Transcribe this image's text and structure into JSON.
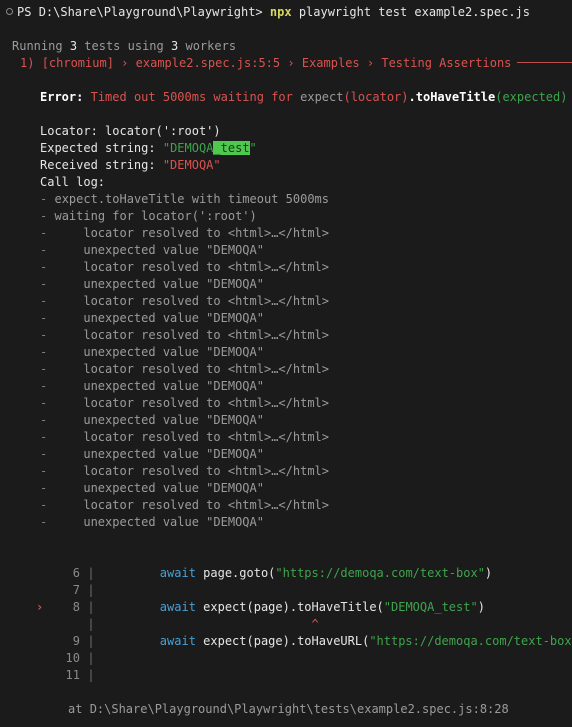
{
  "theme": {
    "background": "#1b1b1b",
    "foreground": "#cccccc",
    "red": "#d9534f",
    "green": "#3fa34d",
    "blue": "#4a9fd4",
    "yellow": "#d7d75f",
    "gray": "#9b9b9b",
    "highlight_bg": "#4ec94e",
    "highlight_fg": "#15361a"
  },
  "prompt": {
    "marker_icon": "circle-ring-icon",
    "shell": "PS",
    "path": "D:\\Share\\Playground\\Playwright>",
    "command_name": "npx",
    "command_args": "playwright test example2.spec.js"
  },
  "run_summary": {
    "prefix": "Running",
    "test_count": "3",
    "middle": "tests using",
    "worker_count": "3",
    "suffix": "workers"
  },
  "failure_header": {
    "index": "1)",
    "project": "[chromium]",
    "sep1": "›",
    "location": "example2.spec.js:5:5",
    "sep2": "›",
    "suite": "Examples",
    "sep3": "›",
    "test": "Testing Assertions"
  },
  "error": {
    "label": "Error:",
    "message": "Timed out 5000ms waiting for",
    "expect_fn": "expect",
    "expect_arg": "(locator)",
    "matcher": ".toHaveTitle",
    "matcher_arg": "(expected)"
  },
  "details": {
    "locator_label": "Locator:",
    "locator_value": "locator(':root')",
    "expected_label": "Expected string:",
    "expected_quote_open": "\"",
    "expected_base": "DEMOQA",
    "expected_diff": "_test",
    "expected_quote_close": "\"",
    "received_label": "Received string:",
    "received_value": "\"DEMOQA\"",
    "call_log_label": "Call log:"
  },
  "call_log": [
    {
      "dash": "-",
      "indent": 0,
      "text": "expect.toHaveTitle with timeout 5000ms"
    },
    {
      "dash": "-",
      "indent": 0,
      "text": "waiting for locator(':root')"
    },
    {
      "dash": "-",
      "indent": 1,
      "text": "locator resolved to <html>…</html>"
    },
    {
      "dash": "-",
      "indent": 1,
      "text": "unexpected value \"DEMOQA\""
    },
    {
      "dash": "-",
      "indent": 1,
      "text": "locator resolved to <html>…</html>"
    },
    {
      "dash": "-",
      "indent": 1,
      "text": "unexpected value \"DEMOQA\""
    },
    {
      "dash": "-",
      "indent": 1,
      "text": "locator resolved to <html>…</html>"
    },
    {
      "dash": "-",
      "indent": 1,
      "text": "unexpected value \"DEMOQA\""
    },
    {
      "dash": "-",
      "indent": 1,
      "text": "locator resolved to <html>…</html>"
    },
    {
      "dash": "-",
      "indent": 1,
      "text": "unexpected value \"DEMOQA\""
    },
    {
      "dash": "-",
      "indent": 1,
      "text": "locator resolved to <html>…</html>"
    },
    {
      "dash": "-",
      "indent": 1,
      "text": "unexpected value \"DEMOQA\""
    },
    {
      "dash": "-",
      "indent": 1,
      "text": "locator resolved to <html>…</html>"
    },
    {
      "dash": "-",
      "indent": 1,
      "text": "unexpected value \"DEMOQA\""
    },
    {
      "dash": "-",
      "indent": 1,
      "text": "locator resolved to <html>…</html>"
    },
    {
      "dash": "-",
      "indent": 1,
      "text": "unexpected value \"DEMOQA\""
    },
    {
      "dash": "-",
      "indent": 1,
      "text": "locator resolved to <html>…</html>"
    },
    {
      "dash": "-",
      "indent": 1,
      "text": "unexpected value \"DEMOQA\""
    },
    {
      "dash": "-",
      "indent": 1,
      "text": "locator resolved to <html>…</html>"
    },
    {
      "dash": "-",
      "indent": 1,
      "text": "unexpected value \"DEMOQA\""
    }
  ],
  "code_frame": {
    "error_marker": "›",
    "caret": "^",
    "lines": [
      {
        "number": "6",
        "marked": false,
        "keyword": "await",
        "rest_pre": " page.goto(",
        "string": "\"https://demoqa.com/text-box\"",
        "rest_post": ")"
      },
      {
        "number": "7",
        "marked": false,
        "keyword": "",
        "rest_pre": "",
        "string": "",
        "rest_post": ""
      },
      {
        "number": "8",
        "marked": true,
        "keyword": "await",
        "rest_pre": " expect(page).toHaveTitle(",
        "string": "\"DEMOQA_test\"",
        "rest_post": ")"
      },
      {
        "number": "9",
        "marked": false,
        "keyword": "await",
        "rest_pre": " expect(page).toHaveURL(",
        "string": "\"https://demoqa.com/text-box\"",
        "rest_post": ")"
      },
      {
        "number": "10",
        "marked": false,
        "keyword": "",
        "rest_pre": "",
        "string": "",
        "rest_post": ""
      },
      {
        "number": "11",
        "marked": false,
        "keyword": "",
        "rest_pre": "",
        "string": "",
        "rest_post": ""
      }
    ]
  },
  "footer": {
    "at_label": "at",
    "path": "D:\\Share\\Playground\\Playwright\\tests\\example2.spec.js:8:28"
  }
}
